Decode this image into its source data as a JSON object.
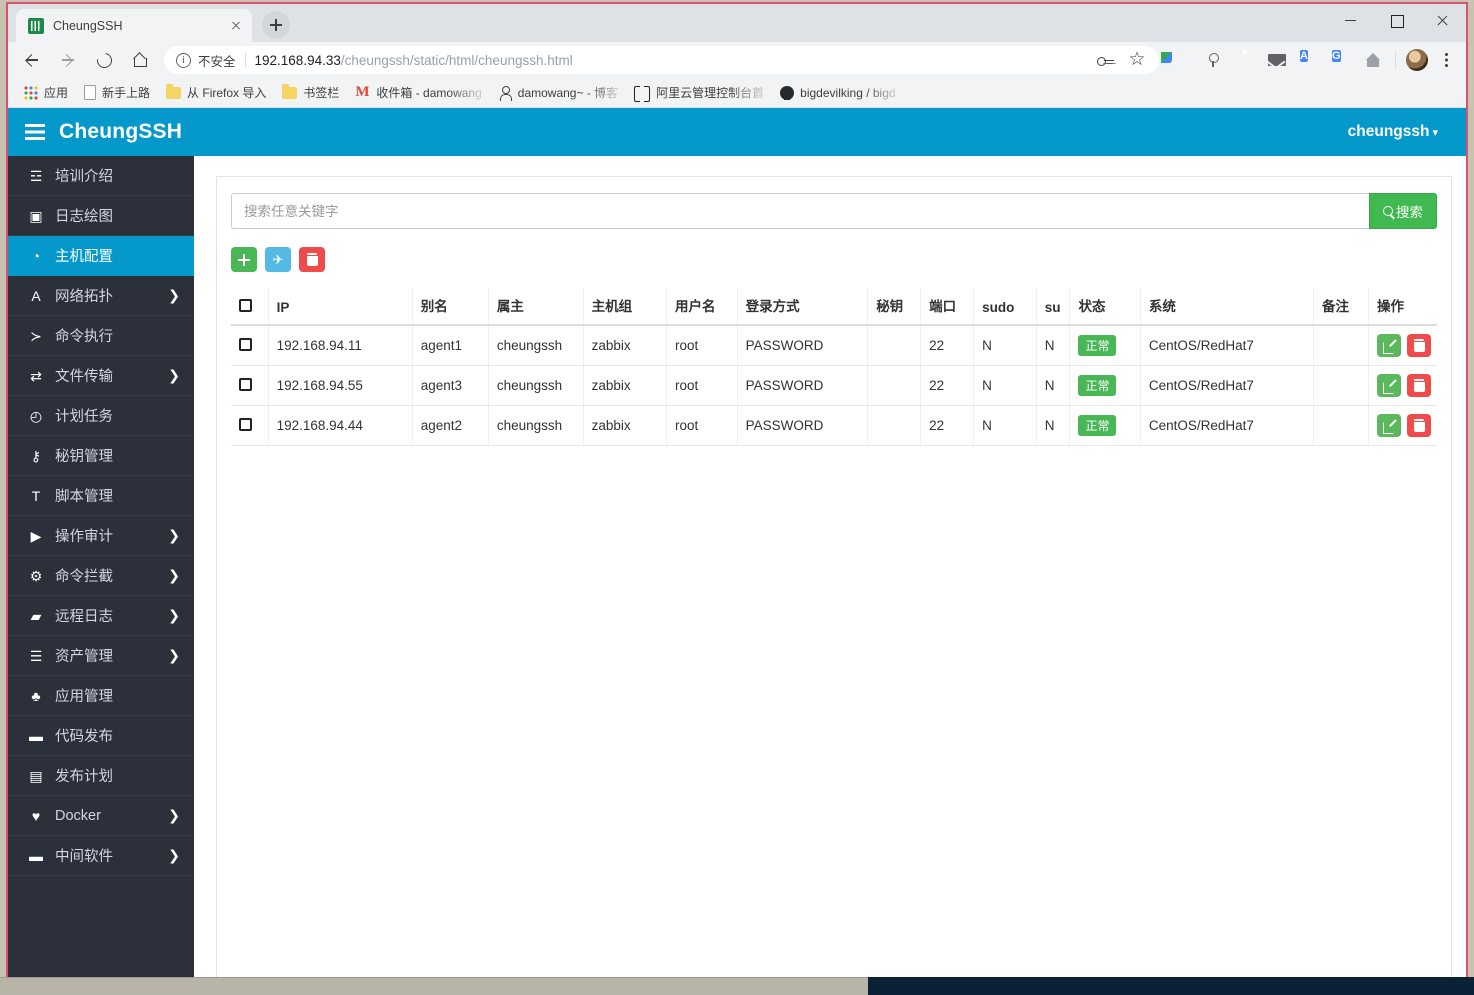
{
  "browser": {
    "tab": {
      "title": "CheungSSH",
      "favicon": "cheungssh-favicon",
      "close": "×"
    },
    "newtab_label": "+",
    "window_controls": {
      "minimize": "—",
      "maximize": "□",
      "close": "✕"
    },
    "omnibox": {
      "security_label": "不安全",
      "url_host": "192.168.94.33",
      "url_path": "/cheungssh/static/html/cheungssh.html"
    },
    "toolbar_icons": [
      "key-icon",
      "star-icon",
      "color-square-extension-icon",
      "microphone-icon",
      "youtube-icon",
      "mail-icon",
      "translate-a-icon",
      "google-translate-icon",
      "home-icon",
      "avatar",
      "browser-menu-icon"
    ],
    "bookmarks": [
      {
        "label": "应用",
        "icon": "apps-grid-icon"
      },
      {
        "label": "新手上路",
        "icon": "page-icon"
      },
      {
        "label": "从 Firefox 导入",
        "icon": "folder-icon"
      },
      {
        "label": "书签栏",
        "icon": "folder-icon"
      },
      {
        "label": "收件箱 - damowang",
        "icon": "gmail-icon"
      },
      {
        "label": "damowang~ - 博客",
        "icon": "person-icon"
      },
      {
        "label": "阿里云管理控制台首",
        "icon": "aliyun-icon"
      },
      {
        "label": "bigdevilking / bigd",
        "icon": "github-icon"
      }
    ]
  },
  "app": {
    "brand": {
      "name": "CheungSSH",
      "menu_icon": "hamburger-icon"
    },
    "user": {
      "name": "cheungssh",
      "caret": "▾"
    },
    "sidebar": [
      {
        "label": "培训介绍",
        "icon": "☲",
        "icon_name": "book-icon",
        "caret": "",
        "active": false
      },
      {
        "label": "日志绘图",
        "icon": "▣",
        "icon_name": "image-chart-icon",
        "caret": "",
        "active": false
      },
      {
        "label": "主机配置",
        "icon": "◔",
        "icon_name": "globe-icon",
        "caret": "",
        "active": true
      },
      {
        "label": "网络拓扑",
        "icon": "A",
        "icon_name": "network-topology-icon",
        "caret": "❯",
        "active": false
      },
      {
        "label": "命令执行",
        "icon": "≻",
        "icon_name": "terminal-icon",
        "caret": "",
        "active": false
      },
      {
        "label": "文件传输",
        "icon": "⇄",
        "icon_name": "file-transfer-icon",
        "caret": "❯",
        "active": false
      },
      {
        "label": "计划任务",
        "icon": "◴",
        "icon_name": "clock-icon",
        "caret": "",
        "active": false
      },
      {
        "label": "秘钥管理",
        "icon": "⚷",
        "icon_name": "key-icon",
        "caret": "",
        "active": false
      },
      {
        "label": "脚本管理",
        "icon": "T",
        "icon_name": "script-text-icon",
        "caret": "",
        "active": false
      },
      {
        "label": "操作审计",
        "icon": "▶",
        "icon_name": "video-camera-icon",
        "caret": "❯",
        "active": false
      },
      {
        "label": "命令拦截",
        "icon": "⚙",
        "icon_name": "gear-icon",
        "caret": "❯",
        "active": false
      },
      {
        "label": "远程日志",
        "icon": "▰",
        "icon_name": "folder-open-icon",
        "caret": "❯",
        "active": false
      },
      {
        "label": "资产管理",
        "icon": "☰",
        "icon_name": "server-stack-icon",
        "caret": "❯",
        "active": false
      },
      {
        "label": "应用管理",
        "icon": "♣",
        "icon_name": "apple-icon",
        "caret": "",
        "active": false
      },
      {
        "label": "代码发布",
        "icon": "▬",
        "icon_name": "briefcase-icon",
        "caret": "",
        "active": false
      },
      {
        "label": "发布计划",
        "icon": "▤",
        "icon_name": "calendar-icon",
        "caret": "",
        "active": false
      },
      {
        "label": "Docker",
        "icon": "♥",
        "icon_name": "heart-docker-icon",
        "caret": "❯",
        "active": false
      },
      {
        "label": "中间软件",
        "icon": "▬",
        "icon_name": "briefcase-icon",
        "caret": "❯",
        "active": false
      }
    ],
    "search": {
      "placeholder": "搜索任意关键字",
      "value": "",
      "button_label": "搜索"
    },
    "action_buttons": [
      {
        "name": "add-host-button",
        "icon": "plus-icon",
        "color": "#49b756"
      },
      {
        "name": "import-host-button",
        "icon": "plane-icon",
        "color": "#54b9e4"
      },
      {
        "name": "delete-host-button",
        "icon": "trash-icon",
        "color": "#ef4b4b"
      }
    ],
    "table": {
      "columns": [
        "",
        "IP",
        "别名",
        "属主",
        "主机组",
        "用户名",
        "登录方式",
        "秘钥",
        "端口",
        "sudo",
        "su",
        "状态",
        "系统",
        "备注",
        "操作"
      ],
      "rows": [
        {
          "ip": "192.168.94.11",
          "alias": "agent1",
          "owner": "cheungssh",
          "group": "zabbix",
          "user": "root",
          "login": "PASSWORD",
          "key": "",
          "port": "22",
          "sudo": "N",
          "su": "N",
          "status": "正常",
          "system": "CentOS/RedHat7",
          "note": ""
        },
        {
          "ip": "192.168.94.55",
          "alias": "agent3",
          "owner": "cheungssh",
          "group": "zabbix",
          "user": "root",
          "login": "PASSWORD",
          "key": "",
          "port": "22",
          "sudo": "N",
          "su": "N",
          "status": "正常",
          "system": "CentOS/RedHat7",
          "note": ""
        },
        {
          "ip": "192.168.94.44",
          "alias": "agent2",
          "owner": "cheungssh",
          "group": "zabbix",
          "user": "root",
          "login": "PASSWORD",
          "key": "",
          "port": "22",
          "sudo": "N",
          "su": "N",
          "status": "正常",
          "system": "CentOS/RedHat7",
          "note": ""
        }
      ],
      "row_actions": [
        {
          "name": "edit-row-button",
          "icon": "pencil-square-icon",
          "color": "#5cb85c"
        },
        {
          "name": "delete-row-button",
          "icon": "trash-icon",
          "color": "#ef4b4b"
        }
      ]
    },
    "colors": {
      "brand_blue": "#0598cb",
      "sidebar_dark": "#2b303b",
      "success_green": "#49b756",
      "danger_red": "#ef4b4b"
    }
  }
}
